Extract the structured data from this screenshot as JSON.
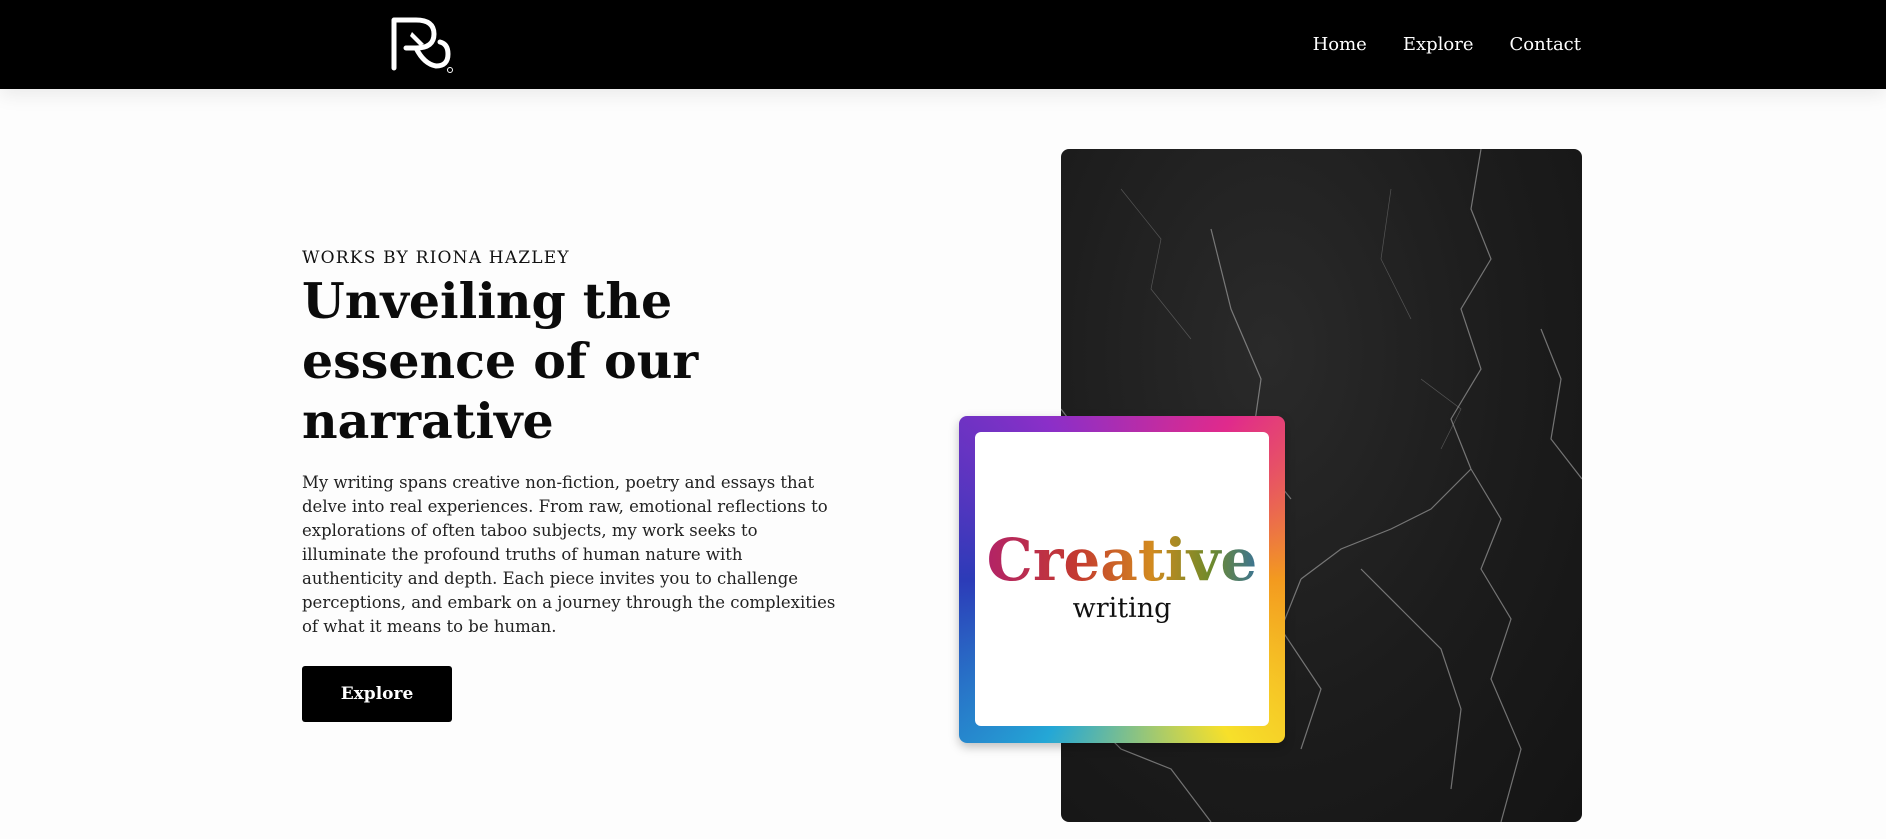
{
  "header": {
    "logo_icon": "rh-monogram-logo",
    "nav": [
      {
        "label": "Home"
      },
      {
        "label": "Explore"
      },
      {
        "label": "Contact"
      }
    ]
  },
  "hero": {
    "eyebrow": "WORKS BY RIONA HAZLEY",
    "title": "Unveiling the essence of our narrative",
    "description": "My writing spans creative non-fiction, poetry and essays that delve into real experiences. From raw, emotional reflections to explorations of often taboo subjects, my work seeks to illuminate the profound truths of human nature with authenticity and depth. Each piece invites you to challenge perceptions, and embark on a journey through the complexities of what it means to be human.",
    "cta_label": "Explore"
  },
  "visual": {
    "card_title": "Creative",
    "card_subtitle": "writing"
  }
}
